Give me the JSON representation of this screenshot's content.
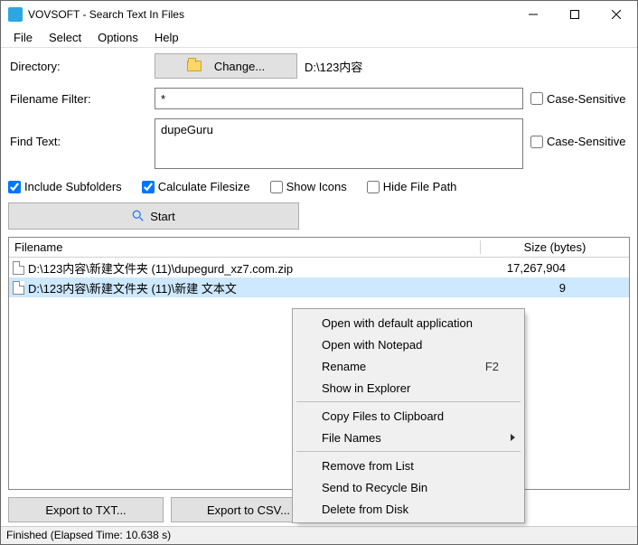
{
  "window": {
    "title": "VOVSOFT - Search Text In Files"
  },
  "menu": {
    "file": "File",
    "select": "Select",
    "options": "Options",
    "help": "Help"
  },
  "labels": {
    "directory": "Directory:",
    "filter": "Filename Filter:",
    "find": "Find Text:",
    "case": "Case-Sensitive",
    "include": "Include Subfolders",
    "calc": "Calculate Filesize",
    "icons": "Show Icons",
    "hide": "Hide File Path",
    "filename_col": "Filename",
    "size_col": "Size (bytes)"
  },
  "buttons": {
    "change": "Change...",
    "start": "Start",
    "export_txt": "Export to TXT...",
    "export_csv": "Export to CSV..."
  },
  "values": {
    "directory": "D:\\123内容",
    "filter": "*",
    "find": "dupeGuru"
  },
  "checked": {
    "include": true,
    "calc": true,
    "icons": false,
    "hide": false,
    "case1": false,
    "case2": false
  },
  "results": [
    {
      "file": "D:\\123内容\\新建文件夹 (11)\\dupegurd_xz7.com.zip",
      "size": "17,267,904",
      "selected": false
    },
    {
      "file": "D:\\123内容\\新建文件夹 (11)\\新建 文本文",
      "size": "9",
      "selected": true
    }
  ],
  "context": {
    "open_default": "Open with default application",
    "open_notepad": "Open with Notepad",
    "rename": "Rename",
    "rename_sc": "F2",
    "show_explorer": "Show in Explorer",
    "copy_clip": "Copy Files to Clipboard",
    "file_names": "File Names",
    "remove": "Remove from List",
    "recycle": "Send to Recycle Bin",
    "delete": "Delete from Disk"
  },
  "status": "Finished (Elapsed Time: 10.638 s)"
}
